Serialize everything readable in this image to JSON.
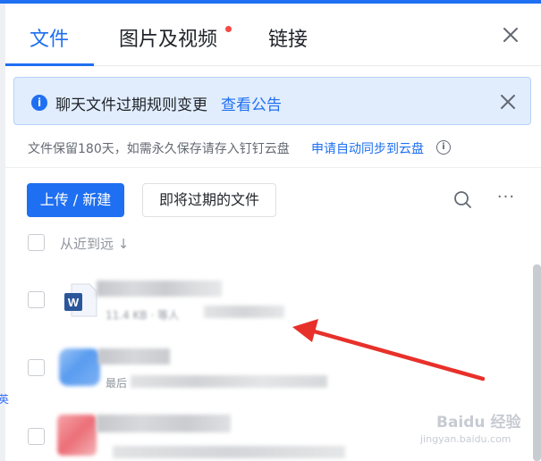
{
  "tabs": [
    {
      "label": "文件",
      "active": true
    },
    {
      "label": "图片及视频",
      "active": false,
      "has_dot": true
    },
    {
      "label": "链接",
      "active": false
    }
  ],
  "notice": {
    "text": "聊天文件过期规则变更",
    "link": "查看公告"
  },
  "hint": {
    "text": "文件保留180天，如需永久保存请存入钉钉云盘",
    "link": "申请自动同步到云盘"
  },
  "toolbar": {
    "upload_label": "上传 / 新建",
    "expiring_label": "即将过期的文件"
  },
  "list": {
    "sort_label": "从近到远 ↓"
  },
  "files": [
    {
      "meta": "11.4 KB · 等人"
    },
    {
      "meta": "最后"
    },
    {
      "meta": ""
    }
  ],
  "left_edge_char": "英",
  "watermark": {
    "main": "Baidu 经验",
    "sub": "jingyan.baidu.com"
  },
  "colors": {
    "accent": "#1e6ff1",
    "arrow": "#e8302a",
    "notice_bg": "#e1edfd"
  }
}
